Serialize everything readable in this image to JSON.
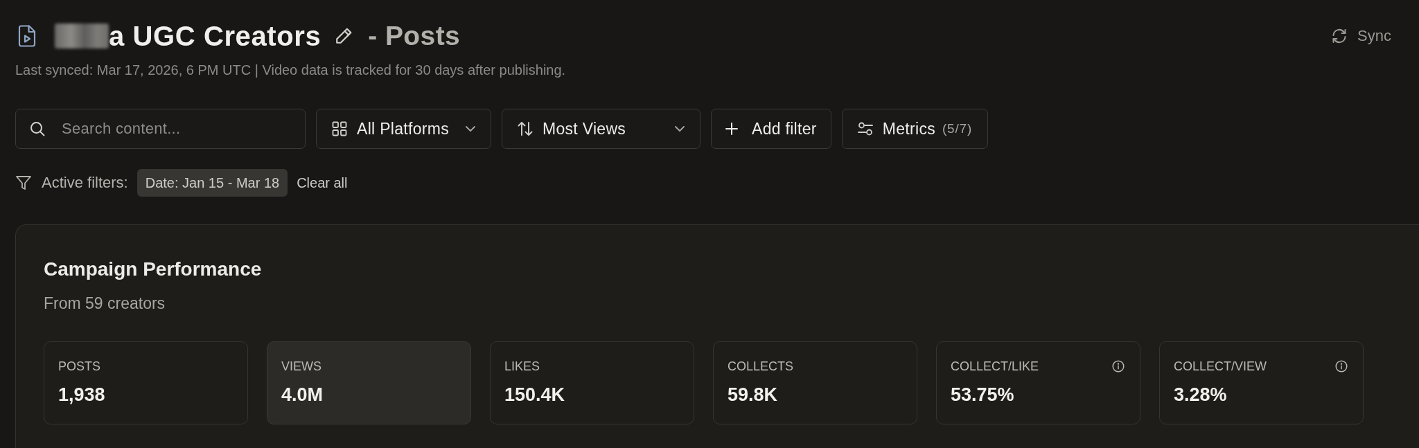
{
  "header": {
    "title": "a UGC Creators",
    "suffix": "- Posts",
    "subtitle": "Last synced: Mar 17, 2026, 6 PM UTC | Video data is tracked for 30 days after publishing.",
    "sync_button": "Sync"
  },
  "toolbar": {
    "search": {
      "placeholder": "Search content..."
    },
    "selects": [
      {
        "kind": "platform",
        "value": "All Platforms"
      },
      {
        "kind": "sort",
        "value": "Most Views"
      }
    ],
    "add_filter": "Add filter",
    "metrics_button": {
      "label": "Metrics",
      "count": "(5/7)"
    }
  },
  "active_filters": {
    "label": "Active filters:",
    "chips": [
      "Date: Jan 15 - Mar 18"
    ],
    "clear": "Clear all"
  },
  "campaign": {
    "title": "Campaign Performance",
    "subtitle": "From 59 creators",
    "metrics": [
      {
        "label": "POSTS",
        "value": "1,938",
        "kind": "count",
        "selected": false
      },
      {
        "label": "VIEWS",
        "value": "4.0M",
        "kind": "count",
        "selected": true
      },
      {
        "label": "LIKES",
        "value": "150.4K",
        "kind": "count",
        "selected": false
      },
      {
        "label": "COLLECTS",
        "value": "59.8K",
        "kind": "count",
        "selected": false
      },
      {
        "label": "COLLECT/LIKE",
        "value": "53.75%",
        "kind": "ratio",
        "selected": false
      },
      {
        "label": "COLLECT/VIEW",
        "value": "3.28%",
        "kind": "ratio",
        "selected": false
      }
    ]
  }
}
